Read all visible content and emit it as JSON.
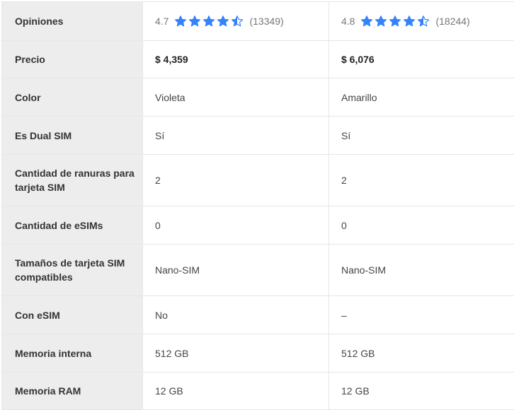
{
  "colors": {
    "star": "#3483fa",
    "label_bg": "#ededed",
    "border": "#e6e6e6"
  },
  "rows": [
    {
      "label": "Opiniones",
      "type": "rating",
      "values": [
        {
          "score": "4.7",
          "stars": 4.5,
          "count": "(13349)"
        },
        {
          "score": "4.8",
          "stars": 4.5,
          "count": "(18244)"
        }
      ]
    },
    {
      "label": "Precio",
      "type": "price",
      "values": [
        "$ 4,359",
        "$ 6,076"
      ]
    },
    {
      "label": "Color",
      "type": "text",
      "values": [
        "Violeta",
        "Amarillo"
      ]
    },
    {
      "label": "Es Dual SIM",
      "type": "text",
      "values": [
        "Sí",
        "Sí"
      ]
    },
    {
      "label": "Cantidad de ranuras para tarjeta SIM",
      "type": "text",
      "values": [
        "2",
        "2"
      ]
    },
    {
      "label": "Cantidad de eSIMs",
      "type": "text",
      "values": [
        "0",
        "0"
      ]
    },
    {
      "label": "Tamaños de tarjeta SIM compatibles",
      "type": "text",
      "values": [
        "Nano-SIM",
        "Nano-SIM"
      ]
    },
    {
      "label": "Con eSIM",
      "type": "text",
      "values": [
        "No",
        "–"
      ]
    },
    {
      "label": "Memoria interna",
      "type": "text",
      "values": [
        "512 GB",
        "512 GB"
      ]
    },
    {
      "label": "Memoria RAM",
      "type": "text",
      "values": [
        "12 GB",
        "12 GB"
      ]
    }
  ]
}
